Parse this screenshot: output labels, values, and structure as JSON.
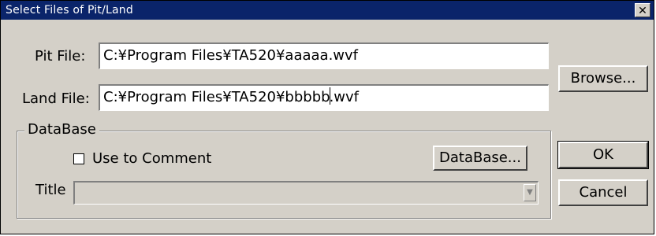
{
  "window": {
    "title": "Select Files of Pit/Land",
    "close_glyph": "✕"
  },
  "pit_file": {
    "label": "Pit File:",
    "value": "C:¥Program Files¥TA520¥aaaaa.wvf"
  },
  "land_file": {
    "label": "Land File:",
    "value_before_caret": "C:¥Program Files¥TA520¥bbbbb",
    "value_after_caret": ".wvf"
  },
  "buttons": {
    "browse": "Browse...",
    "ok": "OK",
    "cancel": "Cancel"
  },
  "database_group": {
    "title": "DataBase",
    "use_to_comment_label": "Use to Comment",
    "use_to_comment_checked": false,
    "database_button": "DataBase...",
    "title_label": "Title",
    "title_value": "",
    "title_enabled": false,
    "combo_arrow_glyph": "▼"
  },
  "colors": {
    "titlebar": "#0a246a",
    "face": "#d4d0c8"
  }
}
